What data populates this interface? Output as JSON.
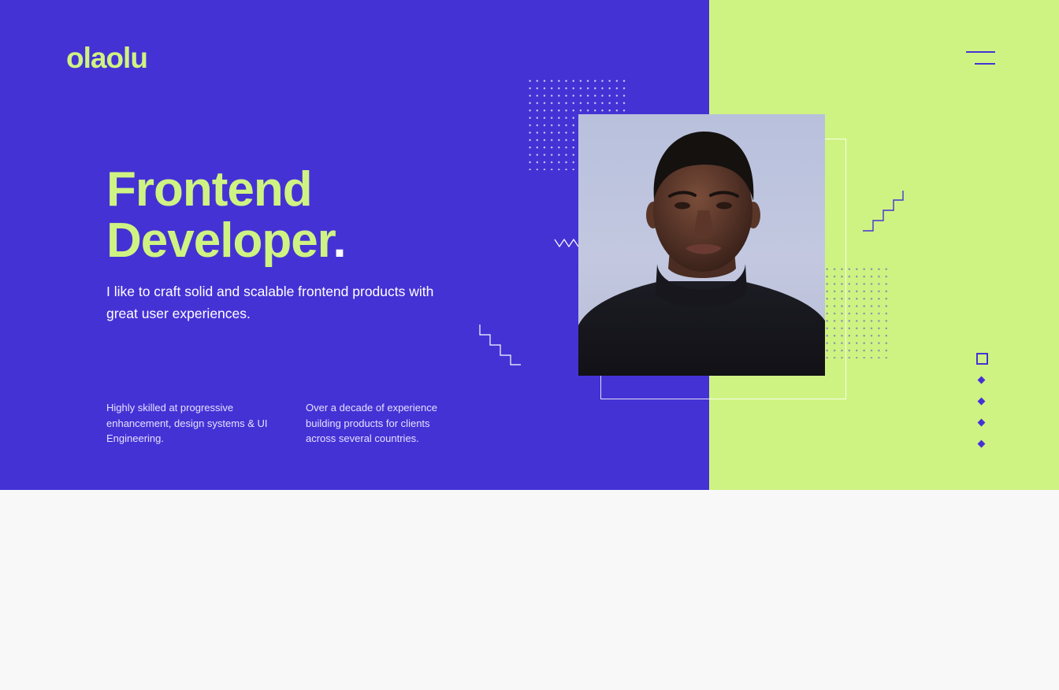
{
  "brand": {
    "logo_text": "olaolu"
  },
  "nav": {
    "menu_icon": "hamburger-menu-icon"
  },
  "hero": {
    "headline_line1": "Frontend",
    "headline_line2": "Developer",
    "headline_dot": ".",
    "intro": "I like to craft solid and scalable frontend products with great user experiences.",
    "features": [
      {
        "text": "Highly skilled at progressive enhancement, design systems & UI Engineering."
      },
      {
        "text": "Over a decade of experience building products for clients across several countries."
      }
    ],
    "portrait_icon": "portrait-photo"
  },
  "pager": {
    "items": [
      {
        "state": "active",
        "icon": "square-outline-icon"
      },
      {
        "state": "inactive",
        "icon": "diamond-icon"
      },
      {
        "state": "inactive",
        "icon": "diamond-icon"
      },
      {
        "state": "inactive",
        "icon": "diamond-icon"
      },
      {
        "state": "inactive",
        "icon": "diamond-icon"
      }
    ]
  },
  "colors": {
    "primary": "#4532d5",
    "accent": "#cff382",
    "text_light": "#ffffff",
    "page_bg": "#f8f8f8"
  }
}
